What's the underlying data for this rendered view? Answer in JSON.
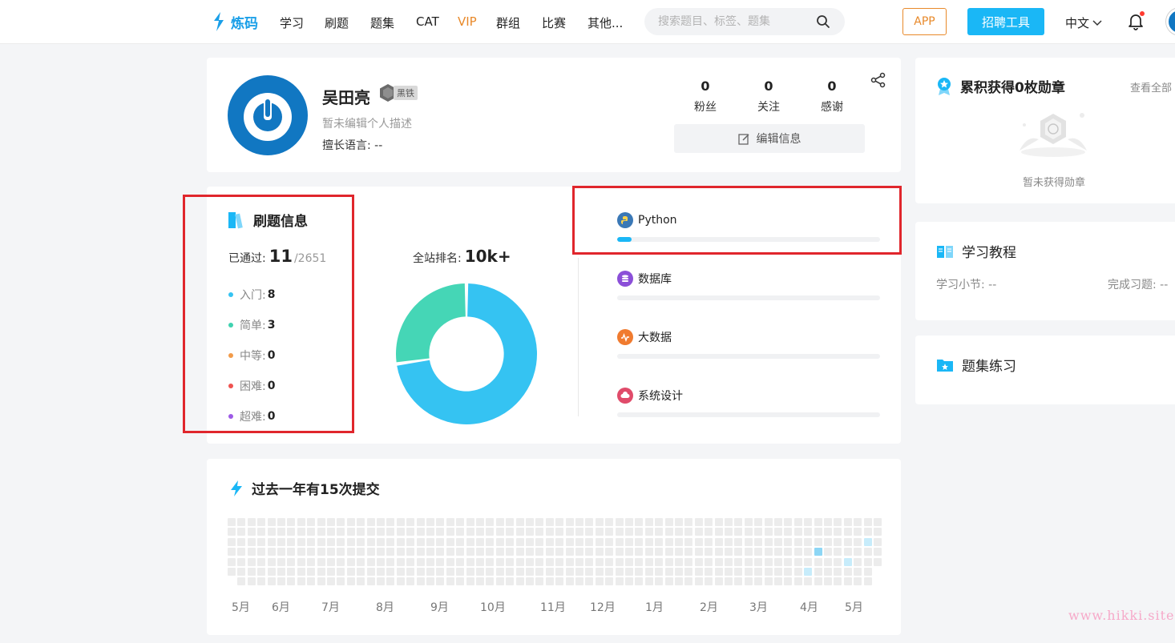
{
  "nav": {
    "logo_text": "炼码",
    "items": [
      "学习",
      "刷题",
      "题集",
      "CAT",
      "VIP",
      "群组",
      "比赛",
      "其他..."
    ],
    "search_placeholder": "搜索题目、标签、题集",
    "app_label": "APP",
    "hire_label": "招聘工具",
    "lang_label": "中文"
  },
  "profile": {
    "name": "吴田亮",
    "rank_badge": "黑铁",
    "bio": "暂未编辑个人描述",
    "language_line": "擅长语言: --",
    "stats": [
      {
        "num": "0",
        "label": "粉丝"
      },
      {
        "num": "0",
        "label": "关注"
      },
      {
        "num": "0",
        "label": "感谢"
      }
    ],
    "edit_label": "编辑信息"
  },
  "practice": {
    "title": "刷题信息",
    "passed_label": "已通过:",
    "passed_count": "11",
    "total": "/2651",
    "difficulties": [
      {
        "label": "入门:",
        "value": "8",
        "color": "#35c3f2"
      },
      {
        "label": "简单:",
        "value": "3",
        "color": "#3fd2b0"
      },
      {
        "label": "中等:",
        "value": "0",
        "color": "#f29b4a"
      },
      {
        "label": "困难:",
        "value": "0",
        "color": "#ef5350"
      },
      {
        "label": "超难:",
        "value": "0",
        "color": "#9d5ae6"
      }
    ],
    "rank_label": "全站排名:",
    "rank_value": "10k+"
  },
  "chart_data": {
    "type": "pie",
    "categories": [
      "入门",
      "简单"
    ],
    "values": [
      8,
      3
    ],
    "colors": [
      "#35c3f2",
      "#45d6b6"
    ],
    "hole": 0.53
  },
  "tracks": [
    {
      "name": "Python",
      "progress": 0.055,
      "icon": "python-icon",
      "color": "#3a78b6"
    },
    {
      "name": "数据库",
      "progress": 0,
      "icon": "database-icon",
      "color": "#8b4fd8"
    },
    {
      "name": "大数据",
      "progress": 0,
      "icon": "bigdata-icon",
      "color": "#f07b2f"
    },
    {
      "name": "系统设计",
      "progress": 0,
      "icon": "system-design-icon",
      "color": "#e04b6a"
    }
  ],
  "submissions": {
    "title": "过去一年有15次提交",
    "months": [
      "5月",
      "6月",
      "7月",
      "8月",
      "9月",
      "10月",
      "11月",
      "12月",
      "1月",
      "2月",
      "3月",
      "4月",
      "5月"
    ]
  },
  "badges": {
    "title": "累积获得0枚勋章",
    "view_all": "查看全部",
    "empty": "暂未获得勋章"
  },
  "tutorial": {
    "title": "学习教程",
    "sections_label": "学习小节: --",
    "exercises_label": "完成习题: --"
  },
  "problem_sets": {
    "title": "题集练习"
  },
  "watermark": "www.hikki.site",
  "colors": {
    "brand": "#1ab7f6",
    "vip": "#e8892a",
    "highlight_box": "#e0262c"
  }
}
